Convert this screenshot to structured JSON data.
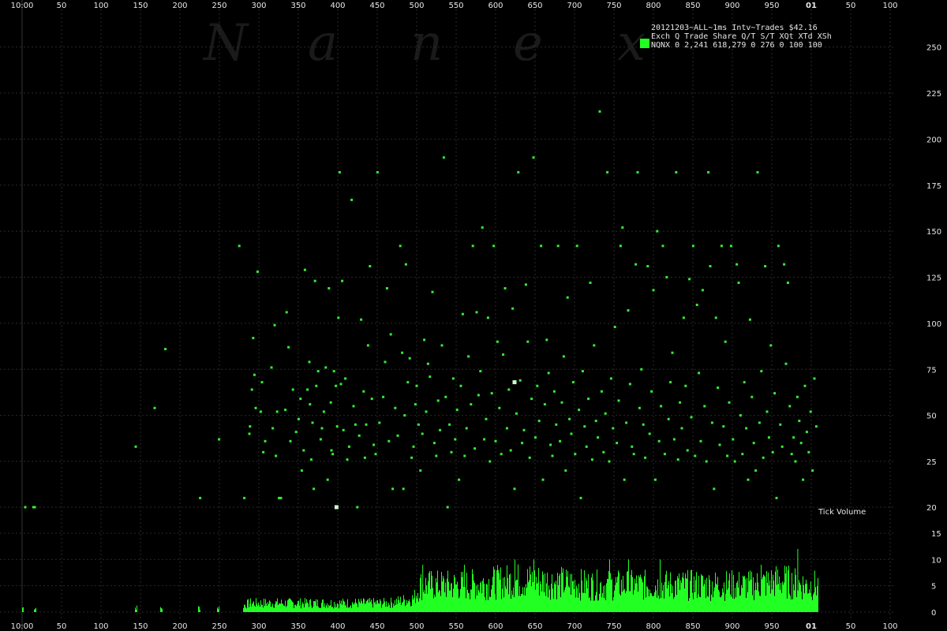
{
  "chart_data": [
    {
      "type": "scatter",
      "title": "20121203~ALL~1ms Intv~Trades $42.16",
      "watermark": [
        "N",
        "a",
        "n",
        "e",
        "x"
      ],
      "legend": {
        "placement": "top-right",
        "header": "Exch Q Trade   Share  Q/T    S/T  XQt XTd XSh",
        "rows": [
          {
            "text": "NQNX 0 2,241 618,279      0   276   0 100 100",
            "color": "#22ff22"
          }
        ]
      },
      "color": "#33ee33",
      "grid": true,
      "x_ticks": [
        "10:00",
        "50",
        "100",
        "150",
        "200",
        "250",
        "300",
        "350",
        "400",
        "450",
        "500",
        "550",
        "600",
        "650",
        "700",
        "750",
        "800",
        "850",
        "900",
        "950",
        "01",
        "50",
        "100"
      ],
      "ylim": [
        20,
        260
      ],
      "y_ticks": [
        20,
        25,
        50,
        75,
        100,
        125,
        150,
        175,
        200,
        225,
        250
      ],
      "points": [
        [
          0.5,
          20
        ],
        [
          2,
          20
        ],
        [
          1.8,
          20
        ],
        [
          18,
          33
        ],
        [
          21,
          54
        ],
        [
          22.7,
          86
        ],
        [
          28.2,
          21
        ],
        [
          31.2,
          37
        ],
        [
          34.4,
          142
        ],
        [
          35.2,
          21
        ],
        [
          36,
          40
        ],
        [
          36.1,
          44
        ],
        [
          36.4,
          64
        ],
        [
          36.6,
          92
        ],
        [
          36.8,
          72
        ],
        [
          37,
          54
        ],
        [
          37.3,
          128
        ],
        [
          37.8,
          52
        ],
        [
          38,
          68
        ],
        [
          38.2,
          30
        ],
        [
          38.5,
          36
        ],
        [
          39.5,
          76
        ],
        [
          39.7,
          43
        ],
        [
          40,
          99
        ],
        [
          40.2,
          28
        ],
        [
          40.4,
          52
        ],
        [
          40.7,
          21
        ],
        [
          41,
          21
        ],
        [
          41.7,
          53
        ],
        [
          41.9,
          106
        ],
        [
          42.2,
          87
        ],
        [
          42.5,
          36
        ],
        [
          42.9,
          64
        ],
        [
          43.4,
          41
        ],
        [
          43.8,
          48
        ],
        [
          44.1,
          59
        ],
        [
          44.3,
          24
        ],
        [
          44.6,
          31
        ],
        [
          44.8,
          129
        ],
        [
          45.2,
          64
        ],
        [
          45.5,
          79
        ],
        [
          45.6,
          56
        ],
        [
          45.8,
          26
        ],
        [
          46,
          46
        ],
        [
          46.2,
          22
        ],
        [
          46.4,
          123
        ],
        [
          46.6,
          66
        ],
        [
          46.9,
          74
        ],
        [
          47.3,
          37
        ],
        [
          47.5,
          43
        ],
        [
          47.8,
          52
        ],
        [
          48.1,
          76
        ],
        [
          48.4,
          23
        ],
        [
          48.6,
          119
        ],
        [
          48.9,
          57
        ],
        [
          49,
          31
        ],
        [
          49.2,
          29
        ],
        [
          49.4,
          74
        ],
        [
          49.7,
          66
        ],
        [
          49.9,
          44
        ],
        [
          50.1,
          103
        ],
        [
          50.3,
          182
        ],
        [
          50.5,
          67
        ],
        [
          50.7,
          123
        ],
        [
          50.9,
          42
        ],
        [
          51.2,
          70
        ],
        [
          51.5,
          26
        ],
        [
          51.8,
          33
        ],
        [
          52.2,
          167
        ],
        [
          52.5,
          55
        ],
        [
          52.8,
          45
        ],
        [
          53.1,
          20
        ],
        [
          53.4,
          39
        ],
        [
          53.7,
          102
        ],
        [
          54.1,
          63
        ],
        [
          54.3,
          27
        ],
        [
          54.5,
          45
        ],
        [
          54.8,
          88
        ],
        [
          55.1,
          131
        ],
        [
          55.4,
          59
        ],
        [
          55.7,
          34
        ],
        [
          56,
          29
        ],
        [
          56.3,
          182
        ],
        [
          56.6,
          46
        ],
        [
          57.2,
          60
        ],
        [
          57.5,
          79
        ],
        [
          57.8,
          119
        ],
        [
          58.1,
          36
        ],
        [
          58.4,
          94
        ],
        [
          58.7,
          22
        ],
        [
          59.1,
          54
        ],
        [
          59.5,
          39
        ],
        [
          59.9,
          142
        ],
        [
          60.2,
          84
        ],
        [
          60.4,
          22
        ],
        [
          60.6,
          50
        ],
        [
          60.8,
          132
        ],
        [
          61.1,
          68
        ],
        [
          61.4,
          81
        ],
        [
          61.7,
          27
        ],
        [
          62,
          33
        ],
        [
          62.3,
          56
        ],
        [
          62.5,
          66
        ],
        [
          62.8,
          45
        ],
        [
          63.1,
          24
        ],
        [
          63.4,
          40
        ],
        [
          63.7,
          91
        ],
        [
          64,
          52
        ],
        [
          64.3,
          78
        ],
        [
          64.6,
          71
        ],
        [
          65,
          117
        ],
        [
          65.3,
          35
        ],
        [
          65.6,
          28
        ],
        [
          65.9,
          58
        ],
        [
          66.2,
          42
        ],
        [
          66.5,
          88
        ],
        [
          66.8,
          190
        ],
        [
          67.1,
          60
        ],
        [
          67.4,
          19
        ],
        [
          67.7,
          45
        ],
        [
          68,
          30
        ],
        [
          68.3,
          70
        ],
        [
          68.6,
          37
        ],
        [
          68.9,
          53
        ],
        [
          69.2,
          23
        ],
        [
          69.5,
          66
        ],
        [
          69.8,
          105
        ],
        [
          70.1,
          28
        ],
        [
          70.4,
          43
        ],
        [
          70.7,
          82
        ],
        [
          71.1,
          56
        ],
        [
          71.4,
          142
        ],
        [
          71.7,
          32
        ],
        [
          72,
          106
        ],
        [
          72.3,
          61
        ],
        [
          72.6,
          74
        ],
        [
          72.9,
          152
        ],
        [
          73.2,
          37
        ],
        [
          73.5,
          48
        ],
        [
          73.8,
          103
        ],
        [
          74.1,
          25
        ],
        [
          74.4,
          62
        ],
        [
          74.7,
          142
        ],
        [
          75,
          36
        ],
        [
          75.3,
          90
        ],
        [
          75.6,
          54
        ],
        [
          75.9,
          29
        ],
        [
          76.2,
          83
        ],
        [
          76.5,
          119
        ],
        [
          76.8,
          43
        ],
        [
          77.1,
          64
        ],
        [
          77.4,
          31
        ],
        [
          77.7,
          108
        ],
        [
          78,
          22
        ],
        [
          78.3,
          51
        ],
        [
          78.6,
          182
        ],
        [
          78.9,
          69
        ],
        [
          79.2,
          35
        ],
        [
          79.5,
          42
        ],
        [
          79.8,
          121
        ],
        [
          80.1,
          90
        ],
        [
          80.4,
          27
        ],
        [
          80.7,
          59
        ],
        [
          81,
          190
        ],
        [
          81.3,
          38
        ],
        [
          81.6,
          66
        ],
        [
          81.9,
          47
        ],
        [
          82.2,
          142
        ],
        [
          82.5,
          23
        ],
        [
          82.8,
          56
        ],
        [
          83.1,
          91
        ],
        [
          83.4,
          73
        ],
        [
          83.7,
          34
        ],
        [
          84,
          28
        ],
        [
          84.3,
          63
        ],
        [
          84.6,
          45
        ],
        [
          84.9,
          142
        ],
        [
          85.2,
          36
        ],
        [
          85.5,
          57
        ],
        [
          85.8,
          82
        ],
        [
          86.1,
          24
        ],
        [
          86.4,
          114
        ],
        [
          86.7,
          48
        ],
        [
          87,
          40
        ],
        [
          87.3,
          68
        ],
        [
          87.6,
          29
        ],
        [
          87.9,
          142
        ],
        [
          88.2,
          53
        ],
        [
          88.5,
          21
        ],
        [
          88.8,
          74
        ],
        [
          89.1,
          44
        ],
        [
          89.4,
          33
        ],
        [
          89.7,
          59
        ],
        [
          90,
          122
        ],
        [
          90.3,
          26
        ],
        [
          90.6,
          88
        ],
        [
          90.9,
          47
        ],
        [
          91.2,
          38
        ],
        [
          91.5,
          215
        ],
        [
          91.8,
          63
        ],
        [
          92.1,
          30
        ],
        [
          92.4,
          51
        ],
        [
          92.7,
          182
        ],
        [
          93,
          25
        ],
        [
          93.3,
          70
        ],
        [
          93.6,
          43
        ],
        [
          93.9,
          98
        ],
        [
          94.2,
          35
        ],
        [
          94.5,
          58
        ],
        [
          94.8,
          142
        ],
        [
          95.1,
          152
        ],
        [
          95.4,
          23
        ],
        [
          95.7,
          46
        ],
        [
          96,
          107
        ],
        [
          96.3,
          67
        ],
        [
          96.6,
          33
        ],
        [
          96.9,
          29
        ],
        [
          97.2,
          132
        ],
        [
          97.5,
          182
        ],
        [
          97.8,
          54
        ],
        [
          98.1,
          75
        ],
        [
          98.4,
          45
        ],
        [
          98.7,
          27
        ],
        [
          99.1,
          131
        ],
        [
          99.4,
          40
        ],
        [
          99.7,
          63
        ],
        [
          100,
          118
        ],
        [
          100.3,
          23
        ],
        [
          100.6,
          150
        ],
        [
          100.9,
          36
        ],
        [
          101.2,
          55
        ],
        [
          101.5,
          142
        ],
        [
          101.8,
          29
        ],
        [
          102.1,
          125
        ],
        [
          102.4,
          48
        ],
        [
          102.7,
          68
        ],
        [
          103,
          84
        ],
        [
          103.3,
          37
        ],
        [
          103.6,
          182
        ],
        [
          103.9,
          26
        ],
        [
          104.2,
          57
        ],
        [
          104.5,
          43
        ],
        [
          104.8,
          103
        ],
        [
          105.1,
          66
        ],
        [
          105.4,
          31
        ],
        [
          105.7,
          124
        ],
        [
          106,
          49
        ],
        [
          106.3,
          142
        ],
        [
          106.6,
          28
        ],
        [
          106.9,
          110
        ],
        [
          107.2,
          73
        ],
        [
          107.5,
          36
        ],
        [
          107.8,
          118
        ],
        [
          108.1,
          55
        ],
        [
          108.4,
          25
        ],
        [
          108.7,
          182
        ],
        [
          109,
          131
        ],
        [
          109.3,
          46
        ],
        [
          109.6,
          22
        ],
        [
          109.9,
          103
        ],
        [
          110.2,
          65
        ],
        [
          110.5,
          34
        ],
        [
          110.8,
          142
        ],
        [
          111.1,
          44
        ],
        [
          111.4,
          90
        ],
        [
          111.7,
          28
        ],
        [
          112,
          57
        ],
        [
          112.3,
          142
        ],
        [
          112.6,
          37
        ],
        [
          112.9,
          25
        ],
        [
          113.2,
          132
        ],
        [
          113.5,
          122
        ],
        [
          113.8,
          50
        ],
        [
          114.1,
          29
        ],
        [
          114.4,
          68
        ],
        [
          114.7,
          43
        ],
        [
          115,
          23
        ],
        [
          115.3,
          102
        ],
        [
          115.6,
          60
        ],
        [
          115.9,
          35
        ],
        [
          116.2,
          24
        ],
        [
          116.5,
          182
        ],
        [
          116.8,
          46
        ],
        [
          117.1,
          74
        ],
        [
          117.4,
          27
        ],
        [
          117.7,
          131
        ],
        [
          118,
          52
        ],
        [
          118.3,
          38
        ],
        [
          118.6,
          88
        ],
        [
          118.9,
          30
        ],
        [
          119.2,
          62
        ],
        [
          119.5,
          21
        ],
        [
          119.8,
          142
        ],
        [
          120.1,
          45
        ],
        [
          120.4,
          33
        ],
        [
          120.7,
          132
        ],
        [
          121,
          78
        ],
        [
          121.3,
          122
        ],
        [
          121.6,
          55
        ],
        [
          121.9,
          29
        ],
        [
          122.2,
          38
        ],
        [
          122.5,
          25
        ],
        [
          122.8,
          60
        ],
        [
          123.1,
          47
        ],
        [
          123.4,
          35
        ],
        [
          123.7,
          23
        ],
        [
          124,
          66
        ],
        [
          124.3,
          41
        ],
        [
          124.6,
          30
        ],
        [
          124.9,
          52
        ],
        [
          125.2,
          24
        ],
        [
          125.5,
          70
        ],
        [
          125.8,
          44
        ]
      ]
    },
    {
      "type": "bar",
      "title": "Tick Volume",
      "color": "#22ff22",
      "ylim": [
        0,
        15
      ],
      "y_ticks": [
        0,
        5,
        10,
        15
      ],
      "bins_start": 0,
      "bins_end": 126,
      "bin_width": 0.125,
      "profile": [
        [
          0,
          1
        ],
        [
          2,
          1
        ],
        [
          18,
          1
        ],
        [
          22,
          1
        ],
        [
          28,
          1
        ],
        [
          31,
          1
        ],
        [
          35,
          1.5
        ],
        [
          36,
          2
        ],
        [
          45,
          2
        ],
        [
          52,
          2
        ],
        [
          58,
          2
        ],
        [
          62,
          3
        ],
        [
          63,
          6
        ],
        [
          70,
          6
        ],
        [
          78,
          7
        ],
        [
          81,
          7
        ],
        [
          90,
          6
        ],
        [
          95,
          6
        ],
        [
          100,
          6
        ],
        [
          110,
          6
        ],
        [
          116,
          6
        ],
        [
          120,
          7
        ],
        [
          124,
          6
        ],
        [
          126,
          6
        ]
      ],
      "spikes": [
        [
          63.4,
          9
        ],
        [
          70,
          9
        ],
        [
          78,
          10
        ],
        [
          81,
          10
        ],
        [
          93,
          10
        ],
        [
          96,
          10
        ],
        [
          101,
          10
        ],
        [
          117,
          9
        ],
        [
          122.8,
          12
        ]
      ]
    }
  ]
}
